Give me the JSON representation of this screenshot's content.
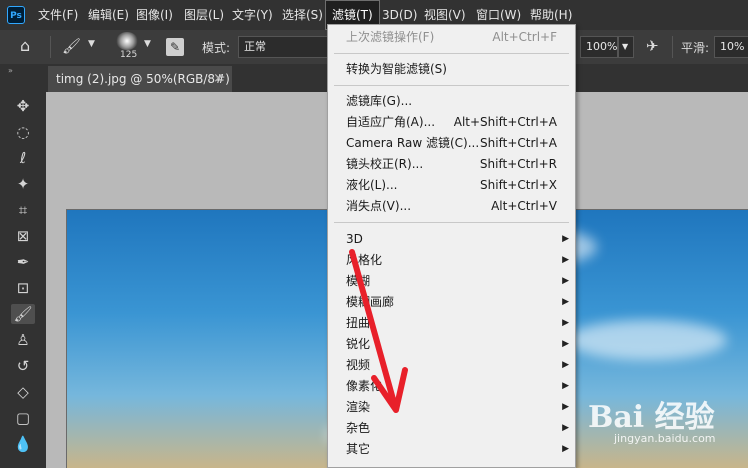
{
  "menubar": {
    "logo": "Ps",
    "items": [
      "文件(F)",
      "编辑(E)",
      "图像(I)",
      "图层(L)",
      "文字(Y)",
      "选择(S)",
      "滤镜(T)",
      "3D(D)",
      "视图(V)",
      "窗口(W)",
      "帮助(H)"
    ],
    "active_index": 6
  },
  "options": {
    "brush_size": "125",
    "mode_label": "模式:",
    "mode_value": "正常",
    "flow_value": "100%",
    "smooth_label": "平滑:",
    "smooth_value": "10%"
  },
  "document": {
    "tab_title": "timg (2).jpg @ 50%(RGB/8#)",
    "close_glyph": "×"
  },
  "filter_menu": {
    "groups": [
      [
        {
          "label": "上次滤镜操作(F)",
          "shortcut": "Alt+Ctrl+F",
          "disabled": true
        }
      ],
      [
        {
          "label": "转换为智能滤镜(S)",
          "shortcut": ""
        }
      ],
      [
        {
          "label": "滤镜库(G)...",
          "shortcut": ""
        },
        {
          "label": "自适应广角(A)...",
          "shortcut": "Alt+Shift+Ctrl+A"
        },
        {
          "label": "Camera Raw 滤镜(C)...",
          "shortcut": "Shift+Ctrl+A"
        },
        {
          "label": "镜头校正(R)...",
          "shortcut": "Shift+Ctrl+R"
        },
        {
          "label": "液化(L)...",
          "shortcut": "Shift+Ctrl+X"
        },
        {
          "label": "消失点(V)...",
          "shortcut": "Alt+Ctrl+V"
        }
      ],
      [
        {
          "label": "3D",
          "submenu": true
        },
        {
          "label": "风格化",
          "submenu": true
        },
        {
          "label": "模糊",
          "submenu": true
        },
        {
          "label": "模糊画廊",
          "submenu": true
        },
        {
          "label": "扭曲",
          "submenu": true
        },
        {
          "label": "锐化",
          "submenu": true
        },
        {
          "label": "视频",
          "submenu": true
        },
        {
          "label": "像素化",
          "submenu": true
        },
        {
          "label": "渲染",
          "submenu": true
        },
        {
          "label": "杂色",
          "submenu": true
        },
        {
          "label": "其它",
          "submenu": true
        }
      ]
    ]
  },
  "annotation": {
    "arrow_color": "#e8202a"
  },
  "watermark": {
    "main": "Bai 经验",
    "sub": "jingyan.baidu.com"
  },
  "icons": {
    "home": "home-icon",
    "brush": "brush-icon",
    "move": "move-icon",
    "marquee": "elliptical-marquee-icon",
    "lasso": "lasso-icon",
    "wand": "magic-wand-icon",
    "crop": "crop-icon",
    "frame": "frame-icon",
    "eyedropper": "eyedropper-icon",
    "heal": "healing-brush-icon",
    "stamp": "clone-stamp-icon",
    "history": "history-brush-icon",
    "eraser": "eraser-icon",
    "gradient": "gradient-icon",
    "blur": "blur-icon"
  }
}
